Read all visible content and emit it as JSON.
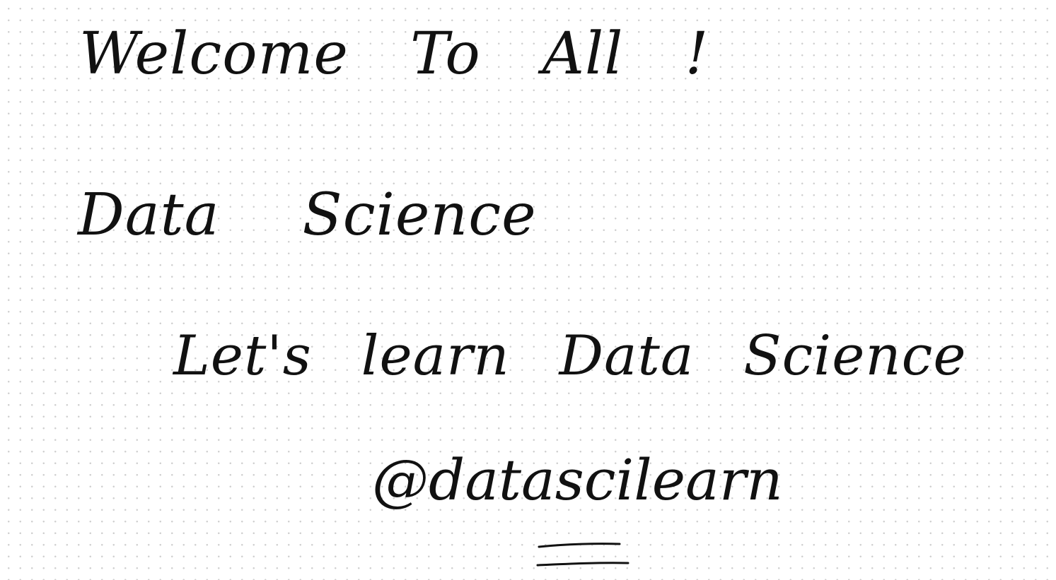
{
  "note": {
    "lines": [
      "Welcome To All !",
      "Data Science",
      "Let's learn Data Science",
      "@datascilearn"
    ]
  },
  "colors": {
    "ink": "#111111",
    "paper": "#ffffff",
    "dot_grid": "#cfcfcf"
  }
}
